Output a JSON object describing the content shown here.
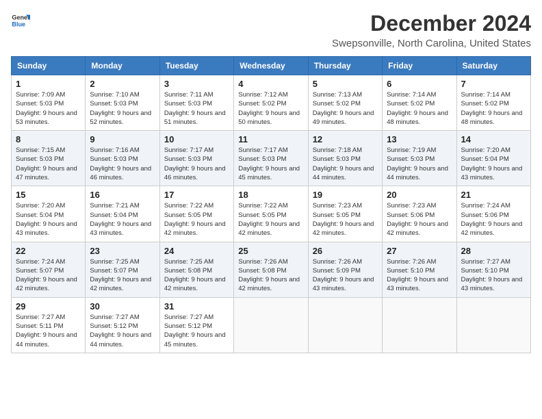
{
  "logo": {
    "line1": "General",
    "line2": "Blue"
  },
  "title": "December 2024",
  "subtitle": "Swepsonville, North Carolina, United States",
  "weekdays": [
    "Sunday",
    "Monday",
    "Tuesday",
    "Wednesday",
    "Thursday",
    "Friday",
    "Saturday"
  ],
  "weeks": [
    [
      {
        "day": "1",
        "sunrise": "Sunrise: 7:09 AM",
        "sunset": "Sunset: 5:03 PM",
        "daylight": "Daylight: 9 hours and 53 minutes."
      },
      {
        "day": "2",
        "sunrise": "Sunrise: 7:10 AM",
        "sunset": "Sunset: 5:03 PM",
        "daylight": "Daylight: 9 hours and 52 minutes."
      },
      {
        "day": "3",
        "sunrise": "Sunrise: 7:11 AM",
        "sunset": "Sunset: 5:03 PM",
        "daylight": "Daylight: 9 hours and 51 minutes."
      },
      {
        "day": "4",
        "sunrise": "Sunrise: 7:12 AM",
        "sunset": "Sunset: 5:02 PM",
        "daylight": "Daylight: 9 hours and 50 minutes."
      },
      {
        "day": "5",
        "sunrise": "Sunrise: 7:13 AM",
        "sunset": "Sunset: 5:02 PM",
        "daylight": "Daylight: 9 hours and 49 minutes."
      },
      {
        "day": "6",
        "sunrise": "Sunrise: 7:14 AM",
        "sunset": "Sunset: 5:02 PM",
        "daylight": "Daylight: 9 hours and 48 minutes."
      },
      {
        "day": "7",
        "sunrise": "Sunrise: 7:14 AM",
        "sunset": "Sunset: 5:02 PM",
        "daylight": "Daylight: 9 hours and 48 minutes."
      }
    ],
    [
      {
        "day": "8",
        "sunrise": "Sunrise: 7:15 AM",
        "sunset": "Sunset: 5:03 PM",
        "daylight": "Daylight: 9 hours and 47 minutes."
      },
      {
        "day": "9",
        "sunrise": "Sunrise: 7:16 AM",
        "sunset": "Sunset: 5:03 PM",
        "daylight": "Daylight: 9 hours and 46 minutes."
      },
      {
        "day": "10",
        "sunrise": "Sunrise: 7:17 AM",
        "sunset": "Sunset: 5:03 PM",
        "daylight": "Daylight: 9 hours and 46 minutes."
      },
      {
        "day": "11",
        "sunrise": "Sunrise: 7:17 AM",
        "sunset": "Sunset: 5:03 PM",
        "daylight": "Daylight: 9 hours and 45 minutes."
      },
      {
        "day": "12",
        "sunrise": "Sunrise: 7:18 AM",
        "sunset": "Sunset: 5:03 PM",
        "daylight": "Daylight: 9 hours and 44 minutes."
      },
      {
        "day": "13",
        "sunrise": "Sunrise: 7:19 AM",
        "sunset": "Sunset: 5:03 PM",
        "daylight": "Daylight: 9 hours and 44 minutes."
      },
      {
        "day": "14",
        "sunrise": "Sunrise: 7:20 AM",
        "sunset": "Sunset: 5:04 PM",
        "daylight": "Daylight: 9 hours and 43 minutes."
      }
    ],
    [
      {
        "day": "15",
        "sunrise": "Sunrise: 7:20 AM",
        "sunset": "Sunset: 5:04 PM",
        "daylight": "Daylight: 9 hours and 43 minutes."
      },
      {
        "day": "16",
        "sunrise": "Sunrise: 7:21 AM",
        "sunset": "Sunset: 5:04 PM",
        "daylight": "Daylight: 9 hours and 43 minutes."
      },
      {
        "day": "17",
        "sunrise": "Sunrise: 7:22 AM",
        "sunset": "Sunset: 5:05 PM",
        "daylight": "Daylight: 9 hours and 42 minutes."
      },
      {
        "day": "18",
        "sunrise": "Sunrise: 7:22 AM",
        "sunset": "Sunset: 5:05 PM",
        "daylight": "Daylight: 9 hours and 42 minutes."
      },
      {
        "day": "19",
        "sunrise": "Sunrise: 7:23 AM",
        "sunset": "Sunset: 5:05 PM",
        "daylight": "Daylight: 9 hours and 42 minutes."
      },
      {
        "day": "20",
        "sunrise": "Sunrise: 7:23 AM",
        "sunset": "Sunset: 5:06 PM",
        "daylight": "Daylight: 9 hours and 42 minutes."
      },
      {
        "day": "21",
        "sunrise": "Sunrise: 7:24 AM",
        "sunset": "Sunset: 5:06 PM",
        "daylight": "Daylight: 9 hours and 42 minutes."
      }
    ],
    [
      {
        "day": "22",
        "sunrise": "Sunrise: 7:24 AM",
        "sunset": "Sunset: 5:07 PM",
        "daylight": "Daylight: 9 hours and 42 minutes."
      },
      {
        "day": "23",
        "sunrise": "Sunrise: 7:25 AM",
        "sunset": "Sunset: 5:07 PM",
        "daylight": "Daylight: 9 hours and 42 minutes."
      },
      {
        "day": "24",
        "sunrise": "Sunrise: 7:25 AM",
        "sunset": "Sunset: 5:08 PM",
        "daylight": "Daylight: 9 hours and 42 minutes."
      },
      {
        "day": "25",
        "sunrise": "Sunrise: 7:26 AM",
        "sunset": "Sunset: 5:08 PM",
        "daylight": "Daylight: 9 hours and 42 minutes."
      },
      {
        "day": "26",
        "sunrise": "Sunrise: 7:26 AM",
        "sunset": "Sunset: 5:09 PM",
        "daylight": "Daylight: 9 hours and 43 minutes."
      },
      {
        "day": "27",
        "sunrise": "Sunrise: 7:26 AM",
        "sunset": "Sunset: 5:10 PM",
        "daylight": "Daylight: 9 hours and 43 minutes."
      },
      {
        "day": "28",
        "sunrise": "Sunrise: 7:27 AM",
        "sunset": "Sunset: 5:10 PM",
        "daylight": "Daylight: 9 hours and 43 minutes."
      }
    ],
    [
      {
        "day": "29",
        "sunrise": "Sunrise: 7:27 AM",
        "sunset": "Sunset: 5:11 PM",
        "daylight": "Daylight: 9 hours and 44 minutes."
      },
      {
        "day": "30",
        "sunrise": "Sunrise: 7:27 AM",
        "sunset": "Sunset: 5:12 PM",
        "daylight": "Daylight: 9 hours and 44 minutes."
      },
      {
        "day": "31",
        "sunrise": "Sunrise: 7:27 AM",
        "sunset": "Sunset: 5:12 PM",
        "daylight": "Daylight: 9 hours and 45 minutes."
      },
      null,
      null,
      null,
      null
    ]
  ]
}
